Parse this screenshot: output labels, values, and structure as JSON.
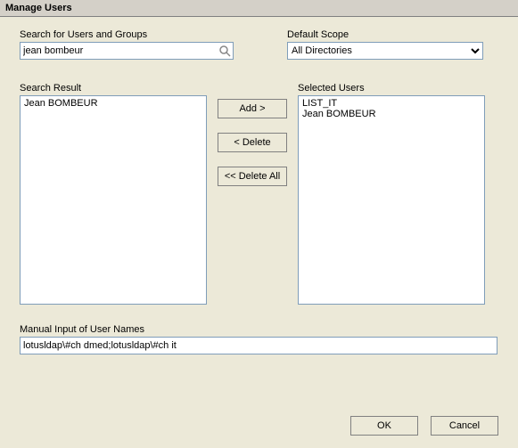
{
  "title": "Manage Users",
  "search": {
    "label": "Search for Users and Groups",
    "value": "jean bombeur",
    "icon": "search-icon"
  },
  "scope": {
    "label": "Default Scope",
    "selected": "All Directories",
    "options": [
      "All Directories"
    ]
  },
  "search_result": {
    "label": "Search Result",
    "items": [
      "Jean BOMBEUR"
    ]
  },
  "selected_users": {
    "label": "Selected Users",
    "items": [
      "LIST_IT",
      "Jean BOMBEUR"
    ]
  },
  "buttons": {
    "add": "Add >",
    "delete": "< Delete",
    "delete_all": "<< Delete All",
    "ok": "OK",
    "cancel": "Cancel"
  },
  "manual": {
    "label": "Manual Input of User Names",
    "value": "lotusldap\\#ch dmed;lotusldap\\#ch it"
  }
}
